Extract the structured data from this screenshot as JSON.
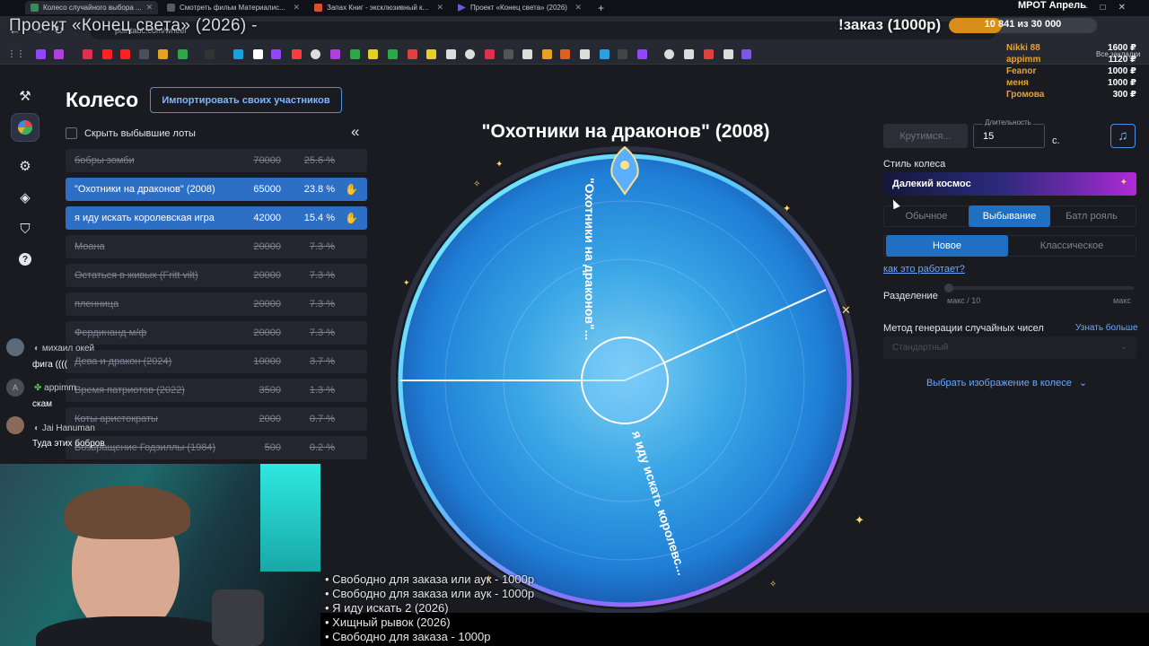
{
  "browser": {
    "tabs": [
      {
        "title": "Колесо случайного выбора ...",
        "active": true
      },
      {
        "title": "Смотреть фильм Материалис..."
      },
      {
        "title": "Запах Книг - эксклюзивный к..."
      },
      {
        "title": "Проект «Конец света» (2026)"
      }
    ],
    "new_tab": "+",
    "url": "pointauc.com/wheel",
    "all_bookmarks": "Все закладки"
  },
  "app": {
    "title": "Колесо",
    "import_button": "Импортировать своих участников",
    "hide_label": "Скрыть выбывшие лоты",
    "collapse": "«",
    "lots": [
      {
        "name": "бобры зомби",
        "amount": "70000",
        "percent": "25.6 %",
        "state": "out"
      },
      {
        "name": "\"Охотники на драконов\" (2008)",
        "amount": "65000",
        "percent": "23.8 %",
        "state": "in"
      },
      {
        "name": "я иду искать королевская игра",
        "amount": "42000",
        "percent": "15.4 %",
        "state": "in"
      },
      {
        "name": "Моана",
        "amount": "20000",
        "percent": "7.3 %",
        "state": "out"
      },
      {
        "name": "Остаться в живых (Fritt vilt)",
        "amount": "20000",
        "percent": "7.3 %",
        "state": "out"
      },
      {
        "name": "пленница",
        "amount": "20000",
        "percent": "7.3 %",
        "state": "out"
      },
      {
        "name": "Фердинанд м/ф",
        "amount": "20000",
        "percent": "7.3 %",
        "state": "out"
      },
      {
        "name": "Дева и дракон (2024)",
        "amount": "10000",
        "percent": "3.7 %",
        "state": "out"
      },
      {
        "name": "Время патриотов (2022)",
        "amount": "3500",
        "percent": "1.3 %",
        "state": "out"
      },
      {
        "name": "Коты аристократы",
        "amount": "2000",
        "percent": "0.7 %",
        "state": "out"
      },
      {
        "name": "Возвращение Годзиллы (1984)",
        "amount": "500",
        "percent": "0.2 %",
        "state": "out"
      }
    ],
    "wheel": {
      "winner_title": "\"Охотники на драконов\" (2008)",
      "segment_top": "\"Охотники на драконов\"...",
      "segment_bottom": "я иду искать королевс..."
    },
    "controls": {
      "spin_button": "Крутимся...",
      "duration_label": "Длительность",
      "duration_value": "15",
      "duration_unit": "с.",
      "style_label": "Стиль колеса",
      "style_value": "Далекий космос",
      "modes": [
        "Обычное",
        "Выбывание",
        "Батл рояль"
      ],
      "active_mode": "Выбывание",
      "variants": [
        "Новое",
        "Классическое"
      ],
      "active_variant": "Новое",
      "how_link": "как это работает?",
      "split_label": "Разделение",
      "split_min": "макс / 10",
      "split_max": "макс",
      "rng_label": "Метод генерации случайных чисел",
      "rng_link": "Узнать больше",
      "rng_value": "Стандартный",
      "image_link": "Выбрать изображение в колесе"
    }
  },
  "stream_overlay": {
    "title": "Проект «Конец света» (2026) -",
    "donation_header": "!заказ (1000р)",
    "goal_title": "МРОТ Апрель",
    "goal_text": "10 841  из 30 000",
    "goal_progress": 0.36,
    "donators": [
      {
        "name": "Nikki 88",
        "amount": "1600 ₽"
      },
      {
        "name": "appimm",
        "amount": "1120 ₽"
      },
      {
        "name": "Feanor",
        "amount": "1000 ₽"
      },
      {
        "name": "меня",
        "amount": "1000 ₽"
      },
      {
        "name": "Громова",
        "amount": "300 ₽"
      }
    ],
    "queue": [
      "• Свободно для заказа или аук - 1000р",
      "• Свободно для заказа или аук - 1000р",
      "• Я иду искать 2 (2026)",
      "• Хищный рывок (2026)",
      "• Свободно для заказа - 1000р"
    ],
    "chat": [
      {
        "user": "михаил окей",
        "text": "фига (((("
      },
      {
        "user": "appimm",
        "text": "скам"
      },
      {
        "user": "Jai Hanuman",
        "text": "Туда этих бобров"
      }
    ]
  }
}
